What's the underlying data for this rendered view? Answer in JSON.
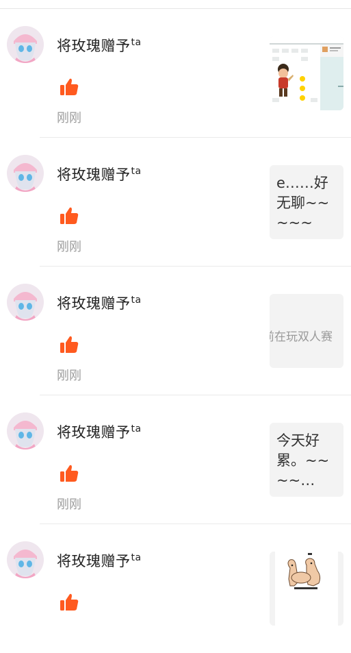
{
  "colors": {
    "like": "#ff5a1f",
    "time": "#9b9b9b",
    "thumb_bg": "#f3f3f3"
  },
  "items": [
    {
      "name": "将玫瑰赠予",
      "sup": "ta",
      "time": "刚刚",
      "thumb": {
        "kind": "image",
        "icon": "game-screenshot-thumbnail"
      }
    },
    {
      "name": "将玫瑰赠予",
      "sup": "ta",
      "time": "刚刚",
      "thumb": {
        "kind": "text",
        "text": "e……好无聊~~~~~"
      }
    },
    {
      "name": "将玫瑰赠予",
      "sup": "ta",
      "time": "刚刚",
      "thumb": {
        "kind": "scroll",
        "text": "前在玩双人赛"
      }
    },
    {
      "name": "将玫瑰赠予",
      "sup": "ta",
      "time": "刚刚",
      "thumb": {
        "kind": "text",
        "text": "今天好累。~~~~…"
      }
    },
    {
      "name": "将玫瑰赠予",
      "sup": "ta",
      "time": "",
      "thumb": {
        "kind": "image",
        "icon": "dog-meme-thumbnail"
      }
    }
  ]
}
